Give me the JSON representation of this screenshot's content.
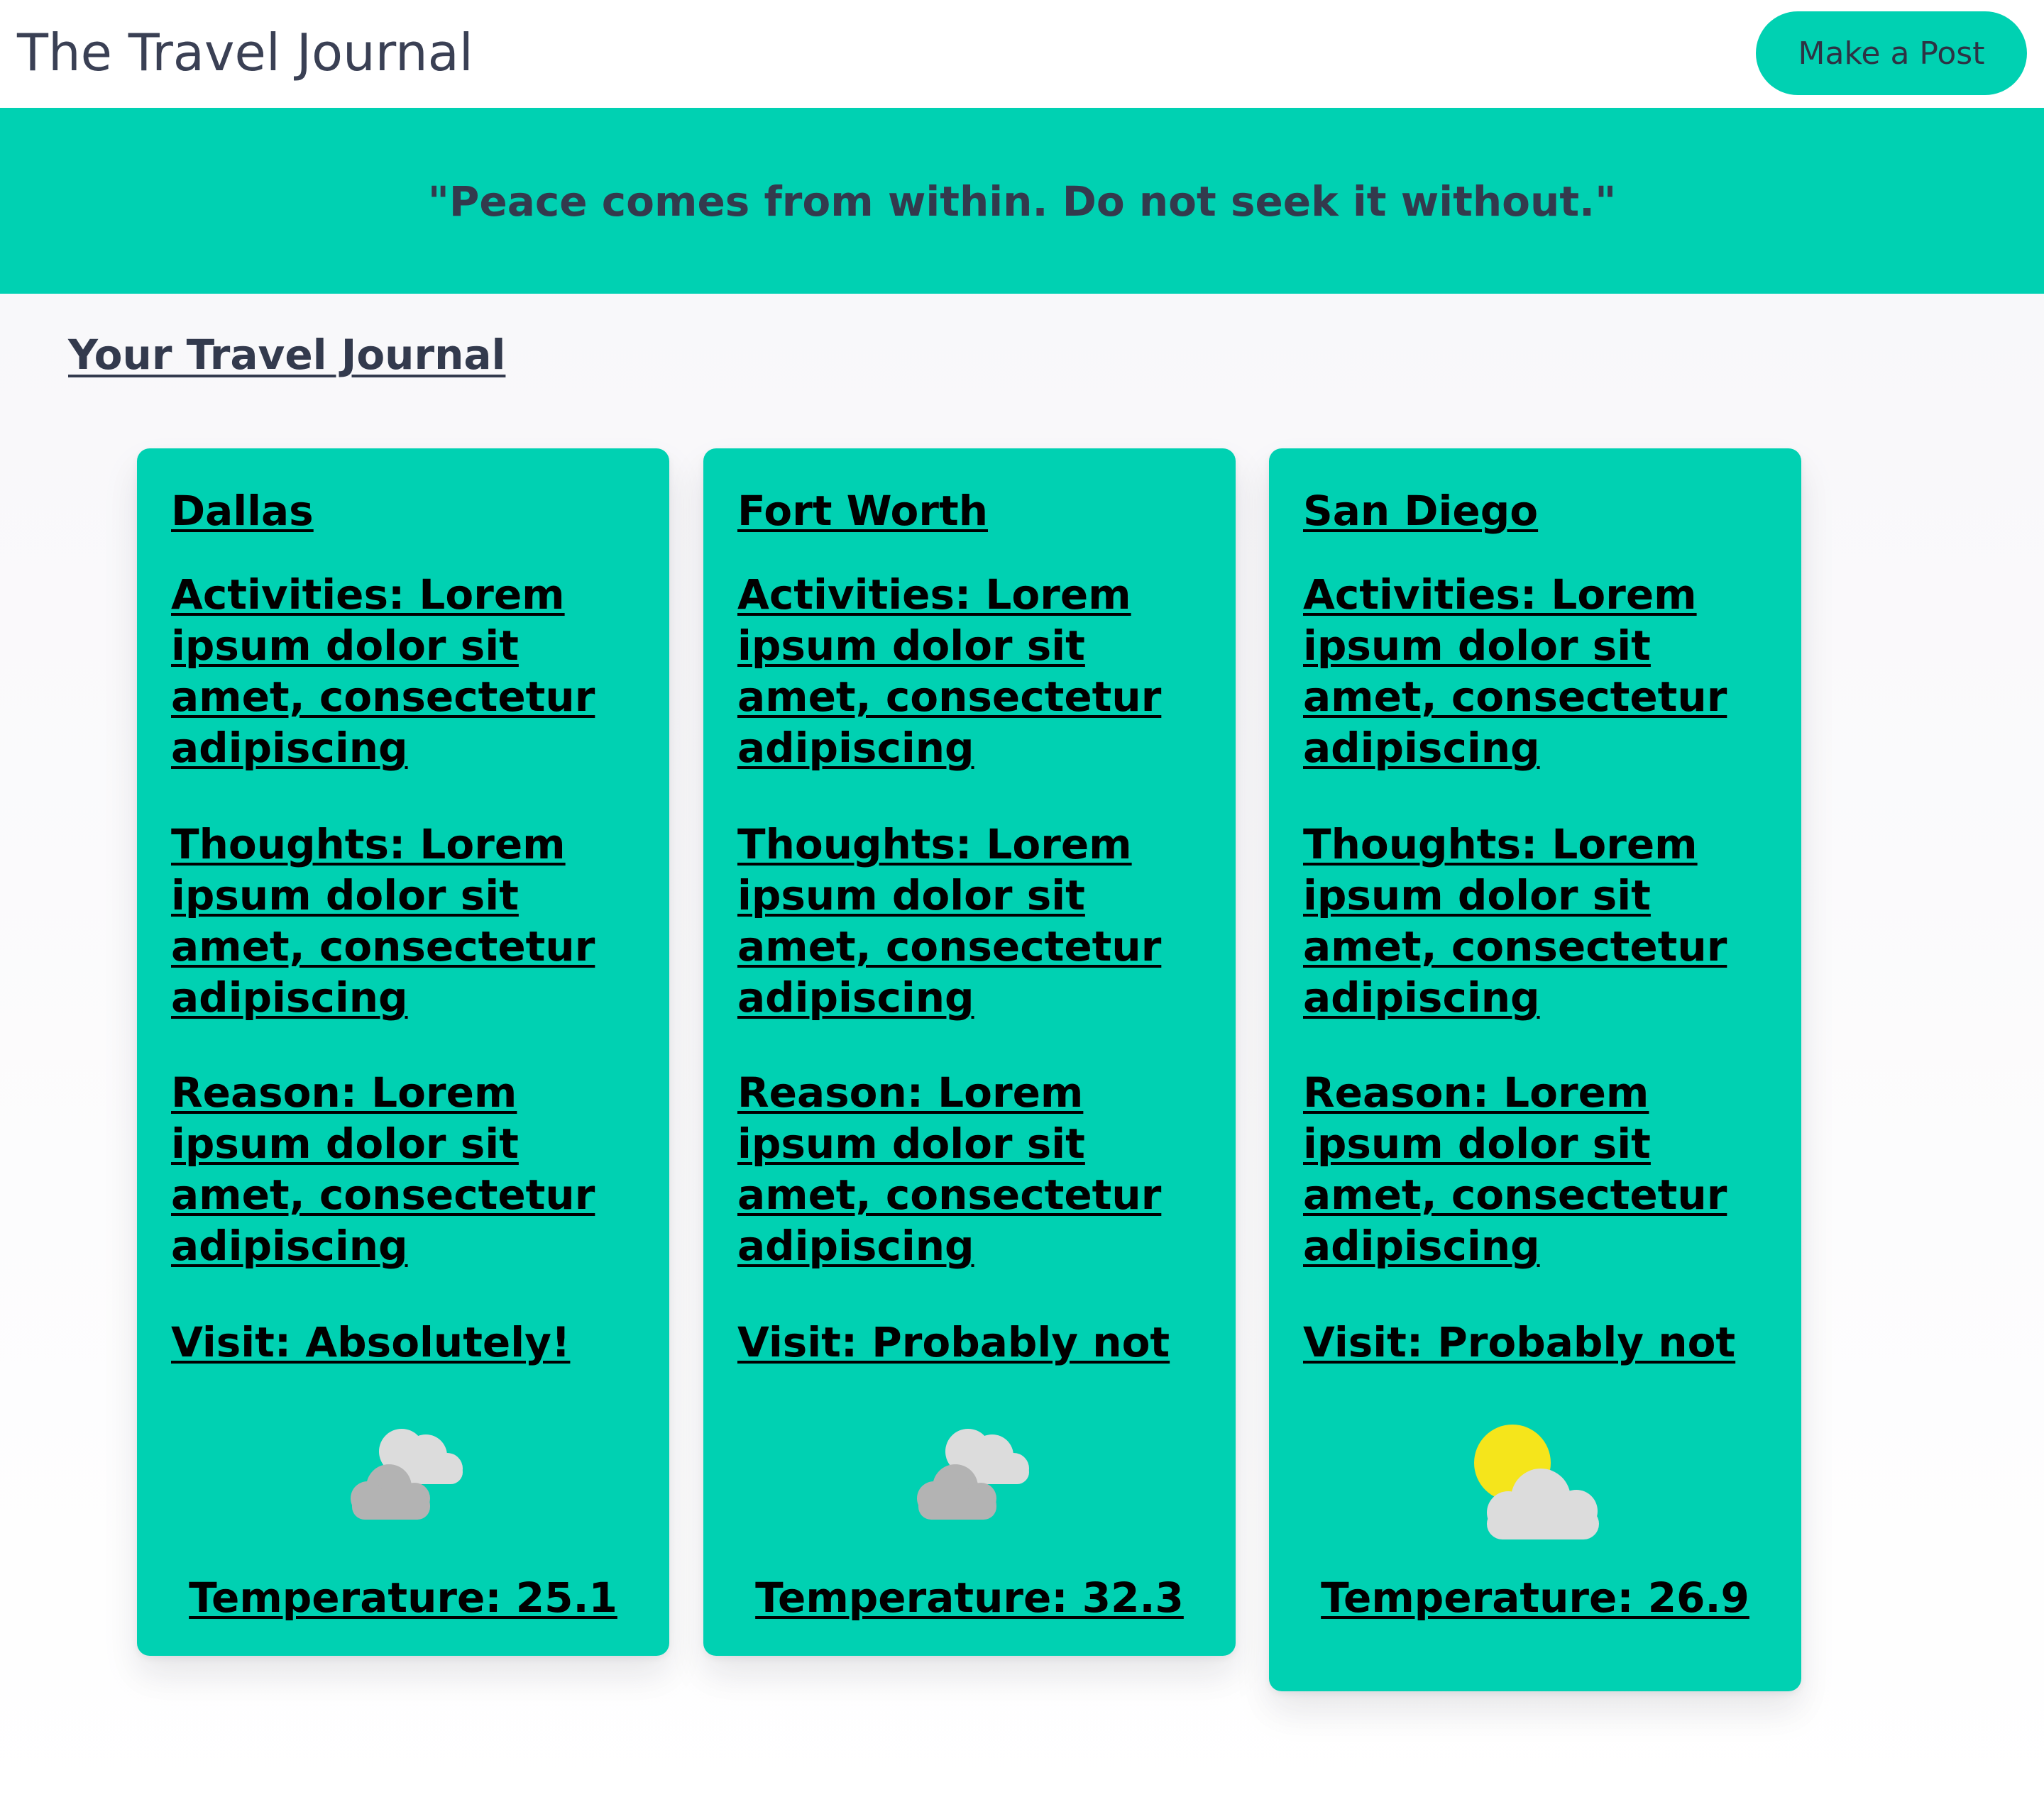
{
  "header": {
    "app_title": "The Travel Journal",
    "make_post_label": "Make a Post"
  },
  "banner": {
    "quote": "\"Peace comes from within. Do not seek it without.\""
  },
  "main": {
    "section_heading": "Your Travel Journal",
    "cards": [
      {
        "city": "Dallas",
        "activities": "Activities: Lorem ipsum dolor sit amet, consectetur adipiscing",
        "thoughts": "Thoughts: Lorem ipsum dolor sit amet, consectetur adipiscing",
        "reason": "Reason: Lorem ipsum dolor sit amet, consectetur adipiscing",
        "visit": "Visit: Absolutely!",
        "weather_icon": "cloudy-icon",
        "temperature": "Temperature: 25.1"
      },
      {
        "city": "Fort Worth",
        "activities": "Activities: Lorem ipsum dolor sit amet, consectetur adipiscing",
        "thoughts": "Thoughts: Lorem ipsum dolor sit amet, consectetur adipiscing",
        "reason": "Reason: Lorem ipsum dolor sit amet, consectetur adipiscing",
        "visit": "Visit: Probably not",
        "weather_icon": "cloudy-icon",
        "temperature": "Temperature: 32.3"
      },
      {
        "city": "San Diego",
        "activities": "Activities: Lorem ipsum dolor sit amet, consectetur adipiscing",
        "thoughts": "Thoughts: Lorem ipsum dolor sit amet, consectetur adipiscing",
        "reason": "Reason: Lorem ipsum dolor sit amet, consectetur adipiscing",
        "visit": "Visit: Probably not",
        "weather_icon": "partly-cloudy-icon",
        "temperature": "Temperature: 26.9"
      }
    ]
  },
  "colors": {
    "accent": "#00d1b2",
    "text_dark": "#333a4d",
    "card_text": "#000000",
    "sun": "#f5e51b",
    "cloud_light": "#dcdcdc",
    "cloud_dark": "#b3b3b3"
  }
}
